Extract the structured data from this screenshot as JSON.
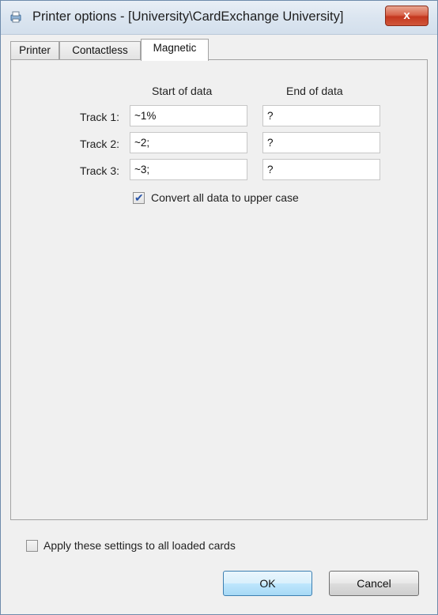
{
  "window": {
    "title": "Printer options - [University\\CardExchange University]",
    "close_label": "x"
  },
  "tabs": [
    {
      "label": "Printer",
      "active": false
    },
    {
      "label": "Contactless",
      "active": false
    },
    {
      "label": "Magnetic",
      "active": true
    }
  ],
  "magnetic": {
    "start_header": "Start of data",
    "end_header": "End of data",
    "tracks": [
      {
        "label": "Track 1:",
        "start": "~1%",
        "end": "?"
      },
      {
        "label": "Track 2:",
        "start": "~2;",
        "end": "?"
      },
      {
        "label": "Track 3:",
        "start": "~3;",
        "end": "?"
      }
    ],
    "uppercase": {
      "label": "Convert all data to upper case",
      "checked": true
    }
  },
  "footer": {
    "apply_all": {
      "label": "Apply these settings to all loaded cards",
      "checked": false
    },
    "ok_label": "OK",
    "cancel_label": "Cancel"
  }
}
